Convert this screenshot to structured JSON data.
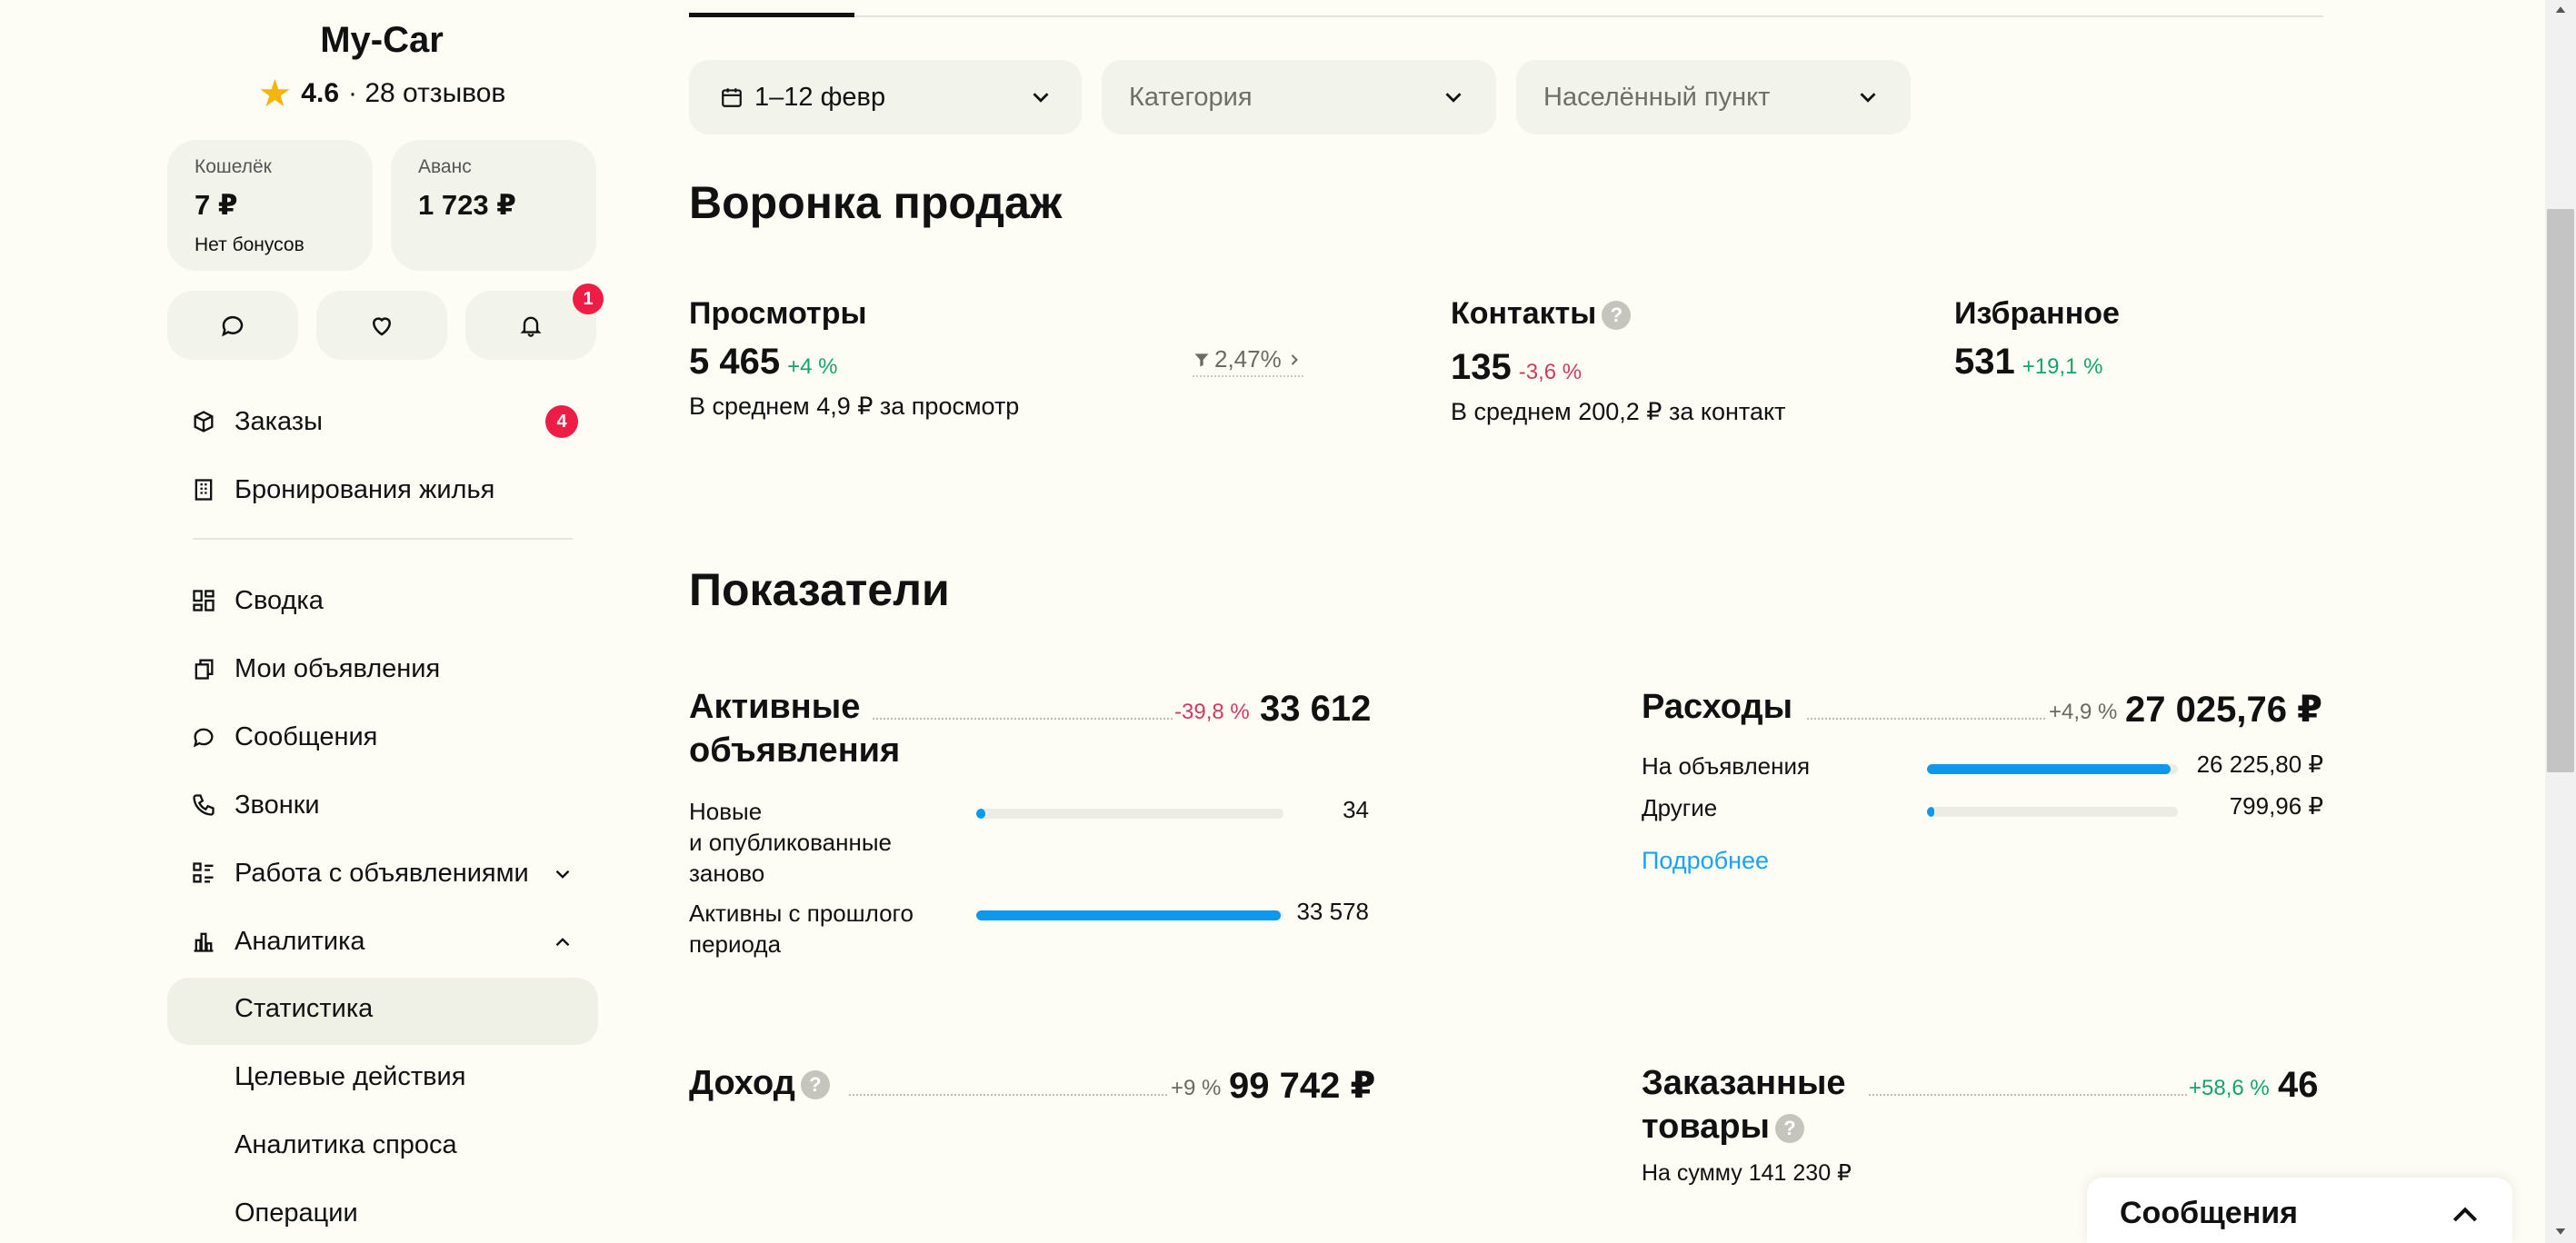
{
  "sidebar": {
    "brand": "My-Car",
    "rating": {
      "score": "4.6",
      "reviews": "· 28 отзывов"
    },
    "wallet": {
      "label": "Кошелёк",
      "value": "7 ₽",
      "sub": "Нет бонусов"
    },
    "advance": {
      "label": "Аванс",
      "value": "1 723 ₽"
    },
    "notifications_badge": "1",
    "nav": {
      "orders": {
        "label": "Заказы",
        "badge": "4"
      },
      "bookings": {
        "label": "Бронирования жилья"
      },
      "summary": {
        "label": "Сводка"
      },
      "my_ads": {
        "label": "Мои объявления"
      },
      "messages": {
        "label": "Сообщения"
      },
      "calls": {
        "label": "Звонки"
      },
      "ad_work": {
        "label": "Работа с объявлениями"
      },
      "analytics": {
        "label": "Аналитика"
      }
    },
    "analytics_sub": {
      "statistics": "Статистика",
      "target_actions": "Целевые действия",
      "demand": "Аналитика спроса",
      "operations": "Операции"
    }
  },
  "filters": {
    "date": "1–12 февр",
    "category": "Категория",
    "locality": "Населённый пункт"
  },
  "funnel": {
    "title": "Воронка продаж",
    "views": {
      "label": "Просмотры",
      "value": "5 465",
      "delta": "+4 %",
      "desc": "В среднем 4,9 ₽ за просмотр"
    },
    "conversion": "2,47%",
    "contacts": {
      "label": "Контакты",
      "value": "135",
      "delta": "-3,6 %",
      "desc": "В среднем 200,2 ₽ за контакт"
    },
    "favorites": {
      "label": "Избранное",
      "value": "531",
      "delta": "+19,1 %"
    }
  },
  "indicators": {
    "title": "Показатели",
    "active_ads": {
      "title_line1": "Активные",
      "title_line2": "объявления",
      "delta": "-39,8 %",
      "value": "33 612",
      "rows": [
        {
          "label_lines": [
            "Новые",
            "и опубликованные",
            "заново"
          ],
          "value": "34",
          "fraction": 0.02
        },
        {
          "label_lines": [
            "Активны с прошлого",
            "периода"
          ],
          "value": "33 578",
          "fraction": 0.99
        }
      ]
    },
    "expenses": {
      "title": "Расходы",
      "delta": "+4,9 %",
      "value": "27 025,76 ₽",
      "rows": [
        {
          "label": "На объявления",
          "value": "26 225,80 ₽",
          "fraction": 0.97
        },
        {
          "label": "Другие",
          "value": "799,96 ₽",
          "fraction": 0.03
        }
      ],
      "more_link": "Подробнее"
    },
    "income": {
      "title": "Доход",
      "delta": "+9 %",
      "value": "99 742 ₽"
    },
    "ordered_goods": {
      "title_line1": "Заказанные",
      "title_line2": "товары",
      "delta": "+58,6 %",
      "value": "46",
      "sub": "На сумму 141 230 ₽"
    }
  },
  "messages_widget": {
    "title": "Сообщения"
  },
  "colors": {
    "accent_blue": "#0b99f0",
    "badge_red": "#ee1d45",
    "positive": "#12a36f",
    "negative": "#d23a5c"
  }
}
